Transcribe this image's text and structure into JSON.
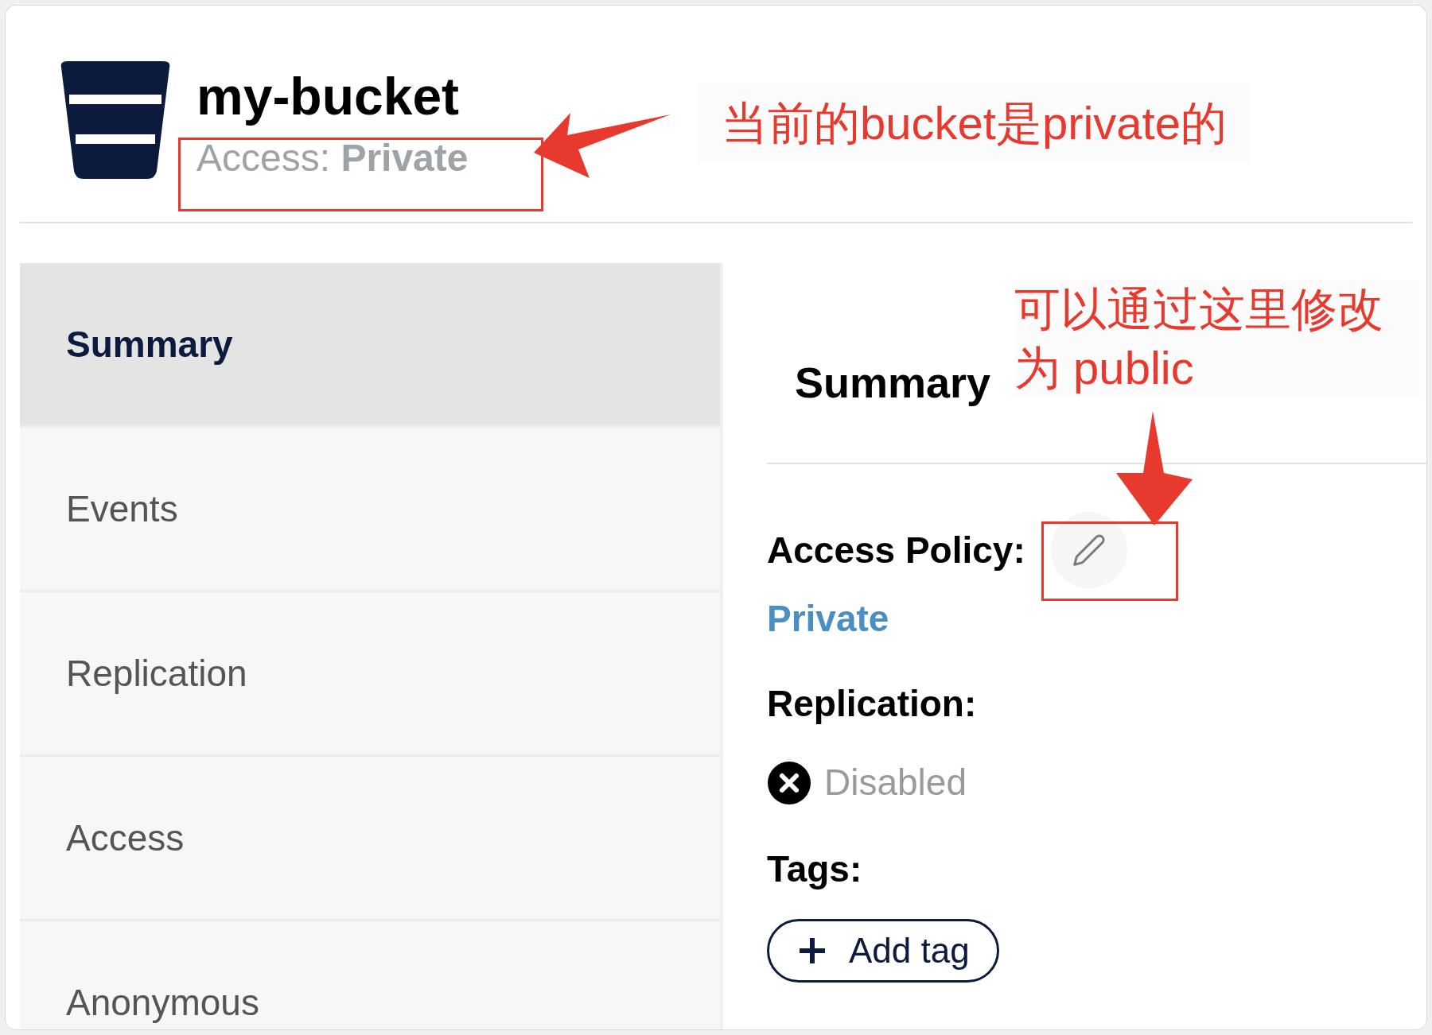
{
  "header": {
    "bucket_name": "my-bucket",
    "access_label": "Access:",
    "access_value": "Private"
  },
  "sidebar": {
    "items": [
      {
        "label": "Summary",
        "selected": true
      },
      {
        "label": "Events",
        "selected": false
      },
      {
        "label": "Replication",
        "selected": false
      },
      {
        "label": "Access",
        "selected": false
      },
      {
        "label": "Anonymous",
        "selected": false
      }
    ]
  },
  "summary": {
    "title": "Summary",
    "access_policy": {
      "label": "Access Policy:",
      "value": "Private"
    },
    "replication": {
      "label": "Replication:",
      "status": "Disabled"
    },
    "tags": {
      "label": "Tags:",
      "button": "Add tag"
    }
  },
  "annotations": [
    {
      "text": "当前的bucket是private的"
    },
    {
      "text": "可以通过这里修改为 public"
    }
  ]
}
